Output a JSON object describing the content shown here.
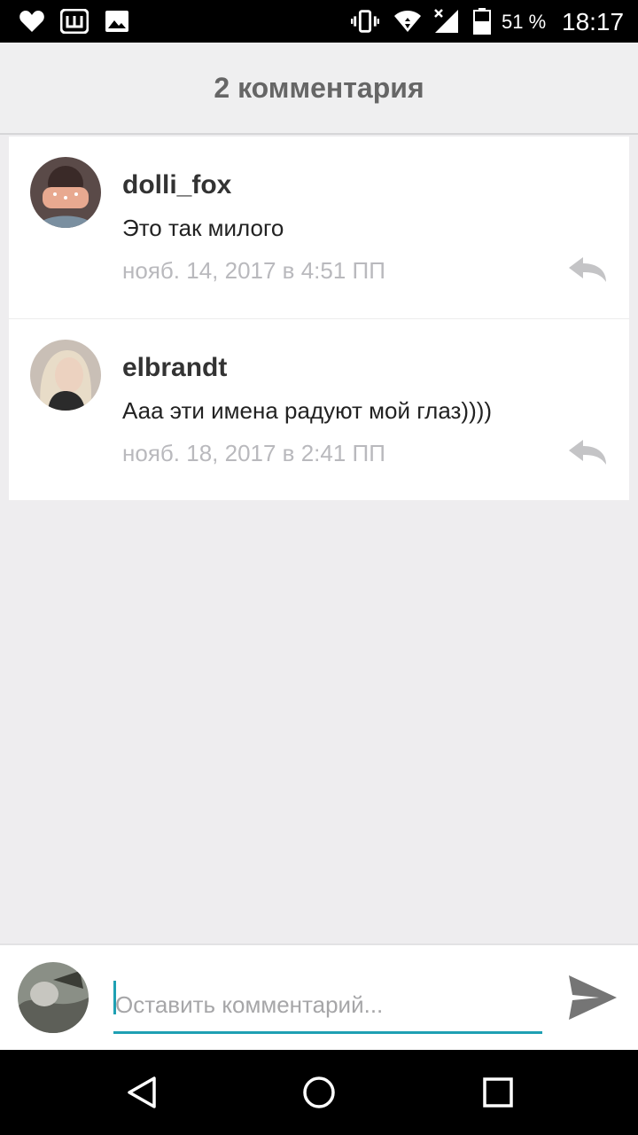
{
  "status_bar": {
    "icons": [
      "heart-icon",
      "app-w-icon",
      "image-icon",
      "vibrate-icon",
      "wifi-icon",
      "no-signal-icon",
      "battery-icon"
    ],
    "battery_percent": "51 %",
    "time": "18:17"
  },
  "header": {
    "title": "2 комментария"
  },
  "comments": [
    {
      "username": "dolli_fox",
      "text": "Это так милого",
      "date": "нояб. 14, 2017 в 4:51 ПП",
      "reply_icon": "reply-icon"
    },
    {
      "username": "elbrandt",
      "text": "Ааа эти имена радуют мой глаз))))",
      "date": "нояб. 18, 2017 в 2:41 ПП",
      "reply_icon": "reply-icon"
    }
  ],
  "input_bar": {
    "placeholder": "Оставить комментарий...",
    "value": "",
    "send_icon": "send-icon"
  },
  "nav_bar": {
    "icons": [
      "back-icon",
      "home-icon",
      "recents-icon"
    ]
  },
  "colors": {
    "accent": "#1ea0b3",
    "background": "#eeedef",
    "status_bar": "#000000"
  }
}
